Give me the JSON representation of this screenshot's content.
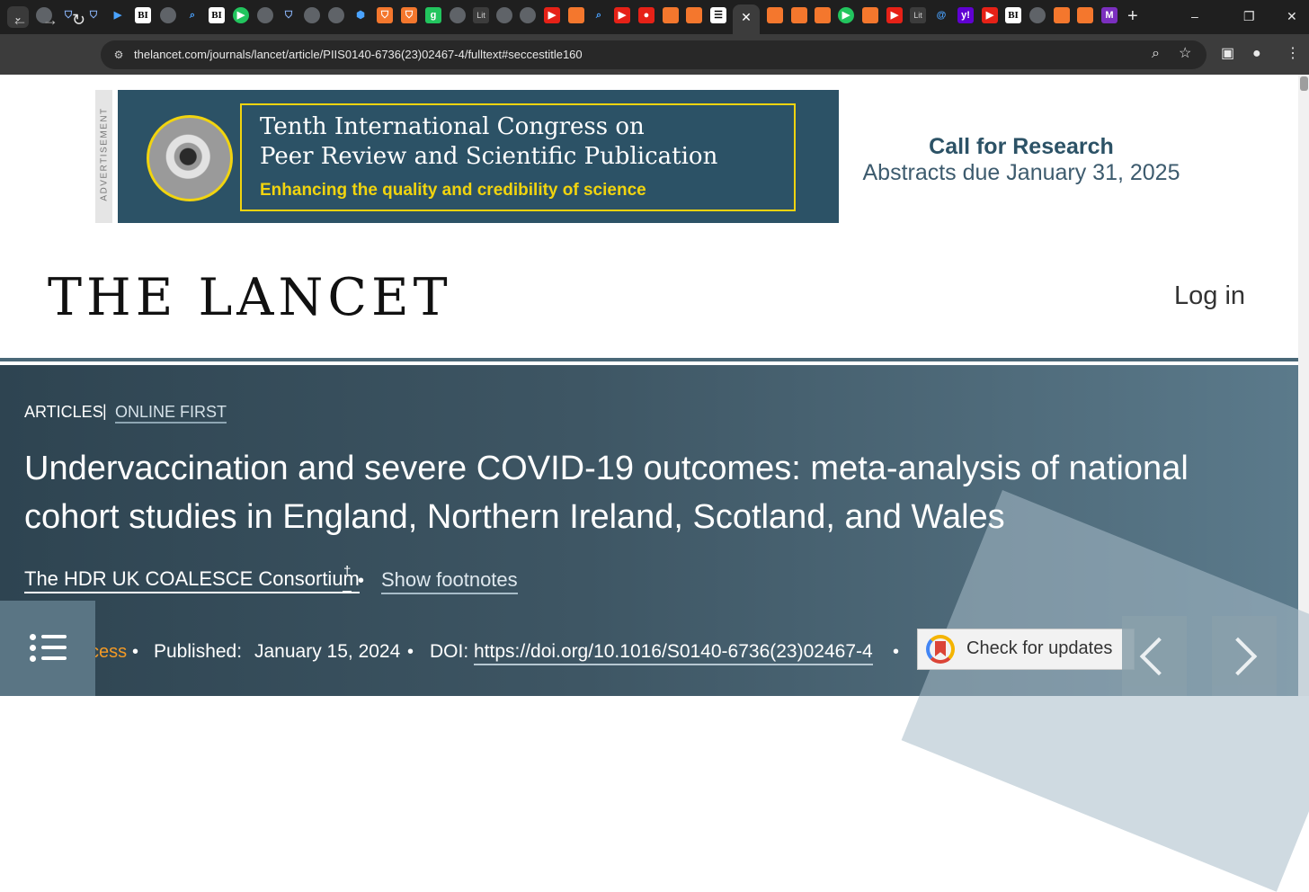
{
  "browser": {
    "url": "thelancet.com/journals/lancet/article/PIIS0140-6736(23)02467-4/fulltext#seccestitle160",
    "active_tab_close": "✕",
    "new_tab": "+",
    "tab_glyphs": {
      "bi": "BI",
      "g": "g",
      "lit": "Lit",
      "y": "y!",
      "at": "@",
      "play": "▶",
      "q": "⌕",
      "m": "M"
    },
    "icons": [
      "back-icon",
      "forward-icon",
      "reload-icon",
      "site-info-icon",
      "zoom-icon",
      "bookmark-star-icon",
      "side-panel-icon",
      "profile-icon",
      "kebab-menu-icon"
    ]
  },
  "ad": {
    "label": "ADVERTISEMENT",
    "title_line1": "Tenth International Congress on",
    "title_line2": "Peer Review and Scientific Publication",
    "tagline": "Enhancing the quality and credibility of science",
    "cta": "Call for Research",
    "due": "Abstracts due January 31, 2025",
    "colors": {
      "background": "#2c5266",
      "accent": "#f1d40f"
    }
  },
  "header": {
    "logo": "THE LANCET",
    "login": "Log in"
  },
  "article": {
    "type": "ARTICLES",
    "separator": "|",
    "status": "ONLINE FIRST",
    "title": "Undervaccination and severe COVID-19 outcomes: meta-analysis of national cohort studies in England, Northern Ireland, Scotland, and Wales",
    "author": "The HDR UK COALESCE Consortium",
    "author_marker": "†",
    "show_footnotes": "Show footnotes",
    "access": "cess",
    "published_label": "Published:",
    "published_date": "January 15, 2024",
    "doi_label": "DOI:",
    "doi": "https://doi.org/10.1016/S0140-6736(23)02467-4",
    "check_updates": "Check for updates",
    "colors": {
      "access": "#f39a26"
    }
  }
}
